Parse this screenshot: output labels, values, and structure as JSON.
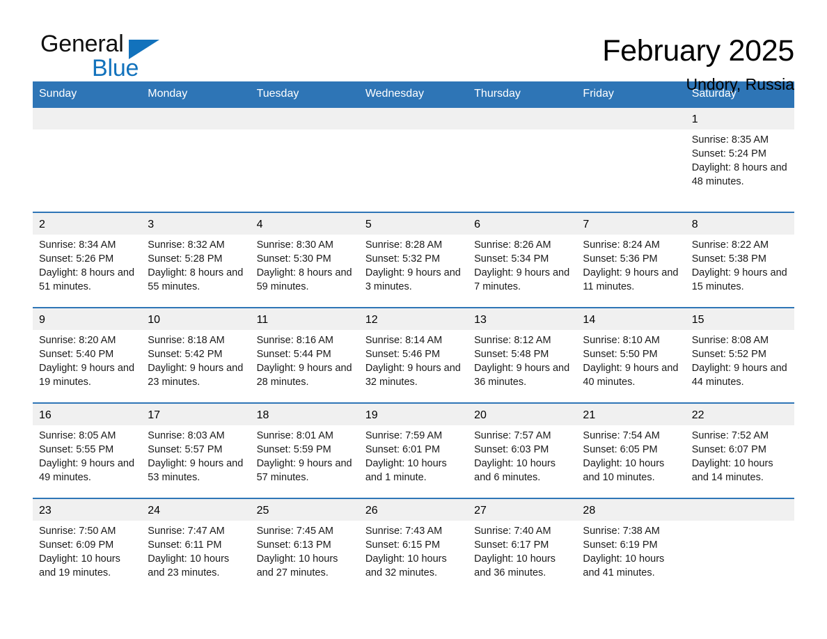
{
  "brand": {
    "name_part1": "General",
    "name_part2": "Blue",
    "flag_icon": "triangle-flag-icon",
    "accent_color": "#1272BC"
  },
  "header": {
    "title": "February 2025",
    "subtitle": "Undory, Russia"
  },
  "theme": {
    "header_bg": "#2E75B6",
    "daynum_bg": "#F0F0F0",
    "row_rule": "#2E75B6",
    "text": "#000000"
  },
  "calendar": {
    "weekdays": [
      "Sunday",
      "Monday",
      "Tuesday",
      "Wednesday",
      "Thursday",
      "Friday",
      "Saturday"
    ],
    "weeks": [
      [
        {
          "day": "",
          "sunrise": "",
          "sunset": "",
          "daylight": ""
        },
        {
          "day": "",
          "sunrise": "",
          "sunset": "",
          "daylight": ""
        },
        {
          "day": "",
          "sunrise": "",
          "sunset": "",
          "daylight": ""
        },
        {
          "day": "",
          "sunrise": "",
          "sunset": "",
          "daylight": ""
        },
        {
          "day": "",
          "sunrise": "",
          "sunset": "",
          "daylight": ""
        },
        {
          "day": "",
          "sunrise": "",
          "sunset": "",
          "daylight": ""
        },
        {
          "day": "1",
          "sunrise": "Sunrise: 8:35 AM",
          "sunset": "Sunset: 5:24 PM",
          "daylight": "Daylight: 8 hours and 48 minutes."
        }
      ],
      [
        {
          "day": "2",
          "sunrise": "Sunrise: 8:34 AM",
          "sunset": "Sunset: 5:26 PM",
          "daylight": "Daylight: 8 hours and 51 minutes."
        },
        {
          "day": "3",
          "sunrise": "Sunrise: 8:32 AM",
          "sunset": "Sunset: 5:28 PM",
          "daylight": "Daylight: 8 hours and 55 minutes."
        },
        {
          "day": "4",
          "sunrise": "Sunrise: 8:30 AM",
          "sunset": "Sunset: 5:30 PM",
          "daylight": "Daylight: 8 hours and 59 minutes."
        },
        {
          "day": "5",
          "sunrise": "Sunrise: 8:28 AM",
          "sunset": "Sunset: 5:32 PM",
          "daylight": "Daylight: 9 hours and 3 minutes."
        },
        {
          "day": "6",
          "sunrise": "Sunrise: 8:26 AM",
          "sunset": "Sunset: 5:34 PM",
          "daylight": "Daylight: 9 hours and 7 minutes."
        },
        {
          "day": "7",
          "sunrise": "Sunrise: 8:24 AM",
          "sunset": "Sunset: 5:36 PM",
          "daylight": "Daylight: 9 hours and 11 minutes."
        },
        {
          "day": "8",
          "sunrise": "Sunrise: 8:22 AM",
          "sunset": "Sunset: 5:38 PM",
          "daylight": "Daylight: 9 hours and 15 minutes."
        }
      ],
      [
        {
          "day": "9",
          "sunrise": "Sunrise: 8:20 AM",
          "sunset": "Sunset: 5:40 PM",
          "daylight": "Daylight: 9 hours and 19 minutes."
        },
        {
          "day": "10",
          "sunrise": "Sunrise: 8:18 AM",
          "sunset": "Sunset: 5:42 PM",
          "daylight": "Daylight: 9 hours and 23 minutes."
        },
        {
          "day": "11",
          "sunrise": "Sunrise: 8:16 AM",
          "sunset": "Sunset: 5:44 PM",
          "daylight": "Daylight: 9 hours and 28 minutes."
        },
        {
          "day": "12",
          "sunrise": "Sunrise: 8:14 AM",
          "sunset": "Sunset: 5:46 PM",
          "daylight": "Daylight: 9 hours and 32 minutes."
        },
        {
          "day": "13",
          "sunrise": "Sunrise: 8:12 AM",
          "sunset": "Sunset: 5:48 PM",
          "daylight": "Daylight: 9 hours and 36 minutes."
        },
        {
          "day": "14",
          "sunrise": "Sunrise: 8:10 AM",
          "sunset": "Sunset: 5:50 PM",
          "daylight": "Daylight: 9 hours and 40 minutes."
        },
        {
          "day": "15",
          "sunrise": "Sunrise: 8:08 AM",
          "sunset": "Sunset: 5:52 PM",
          "daylight": "Daylight: 9 hours and 44 minutes."
        }
      ],
      [
        {
          "day": "16",
          "sunrise": "Sunrise: 8:05 AM",
          "sunset": "Sunset: 5:55 PM",
          "daylight": "Daylight: 9 hours and 49 minutes."
        },
        {
          "day": "17",
          "sunrise": "Sunrise: 8:03 AM",
          "sunset": "Sunset: 5:57 PM",
          "daylight": "Daylight: 9 hours and 53 minutes."
        },
        {
          "day": "18",
          "sunrise": "Sunrise: 8:01 AM",
          "sunset": "Sunset: 5:59 PM",
          "daylight": "Daylight: 9 hours and 57 minutes."
        },
        {
          "day": "19",
          "sunrise": "Sunrise: 7:59 AM",
          "sunset": "Sunset: 6:01 PM",
          "daylight": "Daylight: 10 hours and 1 minute."
        },
        {
          "day": "20",
          "sunrise": "Sunrise: 7:57 AM",
          "sunset": "Sunset: 6:03 PM",
          "daylight": "Daylight: 10 hours and 6 minutes."
        },
        {
          "day": "21",
          "sunrise": "Sunrise: 7:54 AM",
          "sunset": "Sunset: 6:05 PM",
          "daylight": "Daylight: 10 hours and 10 minutes."
        },
        {
          "day": "22",
          "sunrise": "Sunrise: 7:52 AM",
          "sunset": "Sunset: 6:07 PM",
          "daylight": "Daylight: 10 hours and 14 minutes."
        }
      ],
      [
        {
          "day": "23",
          "sunrise": "Sunrise: 7:50 AM",
          "sunset": "Sunset: 6:09 PM",
          "daylight": "Daylight: 10 hours and 19 minutes."
        },
        {
          "day": "24",
          "sunrise": "Sunrise: 7:47 AM",
          "sunset": "Sunset: 6:11 PM",
          "daylight": "Daylight: 10 hours and 23 minutes."
        },
        {
          "day": "25",
          "sunrise": "Sunrise: 7:45 AM",
          "sunset": "Sunset: 6:13 PM",
          "daylight": "Daylight: 10 hours and 27 minutes."
        },
        {
          "day": "26",
          "sunrise": "Sunrise: 7:43 AM",
          "sunset": "Sunset: 6:15 PM",
          "daylight": "Daylight: 10 hours and 32 minutes."
        },
        {
          "day": "27",
          "sunrise": "Sunrise: 7:40 AM",
          "sunset": "Sunset: 6:17 PM",
          "daylight": "Daylight: 10 hours and 36 minutes."
        },
        {
          "day": "28",
          "sunrise": "Sunrise: 7:38 AM",
          "sunset": "Sunset: 6:19 PM",
          "daylight": "Daylight: 10 hours and 41 minutes."
        },
        {
          "day": "",
          "sunrise": "",
          "sunset": "",
          "daylight": ""
        }
      ]
    ]
  }
}
